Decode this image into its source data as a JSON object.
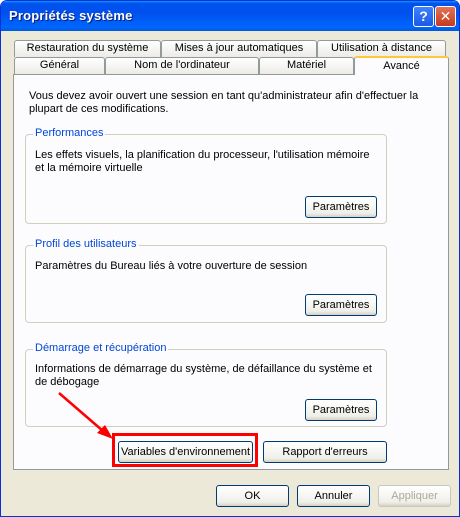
{
  "window": {
    "title": "Propriétés système",
    "help_glyph": "?",
    "close_glyph": "✕"
  },
  "tabs": {
    "row1": [
      "Restauration du système",
      "Mises à jour automatiques",
      "Utilisation à distance"
    ],
    "row2": [
      "Général",
      "Nom de l'ordinateur",
      "Matériel",
      "Avancé"
    ],
    "active": "Avancé"
  },
  "intro_text": "Vous devez avoir ouvert une session en tant qu'administrateur afin d'effectuer la plupart de ces modifications.",
  "groups": {
    "performance": {
      "label": "Performances",
      "text": "Les effets visuels, la planification du processeur, l'utilisation mémoire et la mémoire virtuelle",
      "button": "Paramètres"
    },
    "user_profiles": {
      "label": "Profil des utilisateurs",
      "text": "Paramètres du Bureau liés à votre ouverture de session",
      "button": "Paramètres"
    },
    "startup": {
      "label": "Démarrage et récupération",
      "text": "Informations de démarrage du système, de défaillance du système et de débogage",
      "button": "Paramètres"
    }
  },
  "env_button": "Variables d'environnement",
  "error_report_button": "Rapport d'erreurs",
  "footer": {
    "ok": "OK",
    "cancel": "Annuler",
    "apply": "Appliquer"
  },
  "colors": {
    "titlebar": "#0053ee",
    "group_label": "#0046d5",
    "highlight": "#ff0000",
    "active_tab_accent": "#ffc83c"
  }
}
